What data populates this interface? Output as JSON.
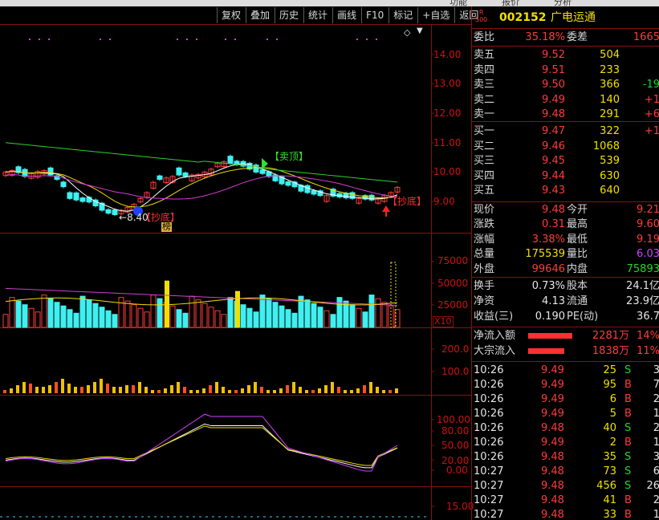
{
  "colors": {
    "up": "#ff3b3b",
    "down": "#3ff0f0",
    "ma_white": "#ffffff",
    "ma_yellow": "#f0e000",
    "ma_magenta": "#d040d0",
    "ma_green": "#30d030",
    "grid": "#8a1010"
  },
  "menu": {
    "item1": "功能",
    "item2": "报价",
    "item3": "分析"
  },
  "toolbar": [
    "复权",
    "叠加",
    "历史",
    "统计",
    "画线",
    "F10",
    "标记",
    "+自选",
    "返回"
  ],
  "price_panel": {
    "axis_ticks": [
      "14.00",
      "13.00",
      "12.00",
      "11.00",
      "10.00",
      "9.00"
    ],
    "low_label": "8.40",
    "annotation_buy": "抄底",
    "annotation_sell": "卖顶",
    "annotation_buy2": "抄底",
    "badge": "榜"
  },
  "volume_panel": {
    "axis_ticks": [
      "75000",
      "50000",
      "25000"
    ],
    "unit": "X10"
  },
  "flow_panel": {
    "axis_ticks": [
      "200.0",
      "100.0"
    ]
  },
  "kdj_panel": {
    "axis_ticks": [
      "100.00",
      "80.00",
      "50.00",
      "20.00",
      "0.00"
    ],
    "extra_tick": "15.00"
  },
  "stock": {
    "code": "002152",
    "name": "广电运通",
    "r_badge": "R",
    "r_num": "500"
  },
  "order_ratio": {
    "label_ratio": "委比",
    "ratio": "35.18%",
    "label_diff": "委差",
    "diff": "1665"
  },
  "asks": [
    {
      "label": "卖五",
      "price": "9.52",
      "vol": "504",
      "chg": ""
    },
    {
      "label": "卖四",
      "price": "9.51",
      "vol": "233",
      "chg": ""
    },
    {
      "label": "卖三",
      "price": "9.50",
      "vol": "366",
      "chg": "-19"
    },
    {
      "label": "卖二",
      "price": "9.49",
      "vol": "140",
      "chg": "+1"
    },
    {
      "label": "卖一",
      "price": "9.48",
      "vol": "291",
      "chg": "+6"
    }
  ],
  "bids": [
    {
      "label": "买一",
      "price": "9.47",
      "vol": "322",
      "chg": "+1"
    },
    {
      "label": "买二",
      "price": "9.46",
      "vol": "1068",
      "chg": ""
    },
    {
      "label": "买三",
      "price": "9.45",
      "vol": "539",
      "chg": ""
    },
    {
      "label": "买四",
      "price": "9.44",
      "vol": "630",
      "chg": ""
    },
    {
      "label": "买五",
      "price": "9.43",
      "vol": "640",
      "chg": ""
    }
  ],
  "stats": {
    "now_label": "现价",
    "now": "9.48",
    "open_label": "今开",
    "open": "9.21",
    "chg_label": "涨跌",
    "chg": "0.31",
    "high_label": "最高",
    "high": "9.60",
    "pct_label": "涨幅",
    "pct": "3.38%",
    "low_label": "最低",
    "low": "9.19",
    "vol_label": "总量",
    "vol": "175539",
    "vr_label": "量比",
    "vr": "6.03",
    "out_label": "外盘",
    "out": "99646",
    "in_label": "内盘",
    "in": "75893"
  },
  "fund": {
    "turn_label": "换手",
    "turn": "0.73%",
    "cap_label": "股本",
    "cap": "24.1亿",
    "nav_label": "净资",
    "nav": "4.13",
    "float_label": "流通",
    "float": "23.9亿",
    "eps_label": "收益(三)",
    "eps": "0.190",
    "pe_label": "PE(动)",
    "pe": "36.7"
  },
  "flows": [
    {
      "label": "净流入额",
      "value": "2281万",
      "pct": "14%",
      "bar": 0.95
    },
    {
      "label": "大宗流入",
      "value": "1838万",
      "pct": "11%",
      "bar": 0.78
    }
  ],
  "ticks": [
    {
      "time": "10:26",
      "price": "9.49",
      "vol": "25",
      "bs": "S",
      "n": "3"
    },
    {
      "time": "10:26",
      "price": "9.49",
      "vol": "95",
      "bs": "B",
      "n": "7"
    },
    {
      "time": "10:26",
      "price": "9.49",
      "vol": "6",
      "bs": "B",
      "n": "2"
    },
    {
      "time": "10:26",
      "price": "9.49",
      "vol": "5",
      "bs": "B",
      "n": "1"
    },
    {
      "time": "10:26",
      "price": "9.48",
      "vol": "40",
      "bs": "S",
      "n": "2"
    },
    {
      "time": "10:26",
      "price": "9.49",
      "vol": "2",
      "bs": "B",
      "n": "1"
    },
    {
      "time": "10:26",
      "price": "9.48",
      "vol": "35",
      "bs": "S",
      "n": "3"
    },
    {
      "time": "10:27",
      "price": "9.48",
      "vol": "73",
      "bs": "S",
      "n": "6"
    },
    {
      "time": "10:27",
      "price": "9.48",
      "vol": "456",
      "bs": "S",
      "n": "26"
    },
    {
      "time": "10:27",
      "price": "9.48",
      "vol": "41",
      "bs": "B",
      "n": "2"
    },
    {
      "time": "10:27",
      "price": "9.48",
      "vol": "33",
      "bs": "B",
      "n": "1"
    }
  ]
}
